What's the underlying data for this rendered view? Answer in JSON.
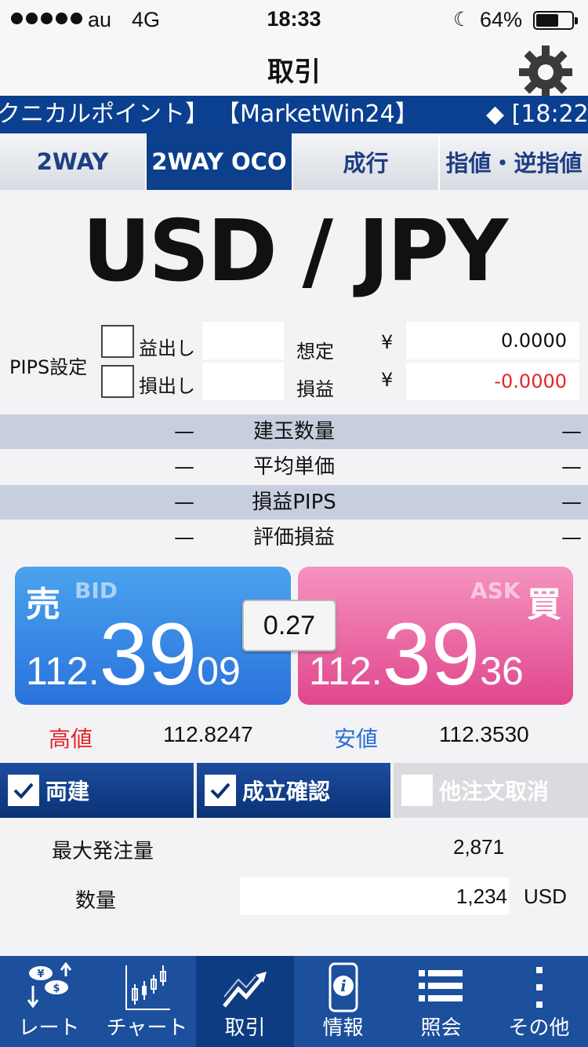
{
  "status_bar": {
    "carrier": "au",
    "network": "4G",
    "time": "18:33",
    "battery": "64%",
    "battery_level": 0.64
  },
  "header": {
    "title": "取引"
  },
  "ticker": {
    "part1": "クニカルポイント】",
    "part2": "【MarketWin24】",
    "part3": "◆ [18:22"
  },
  "order_tabs": [
    {
      "label": "2WAY"
    },
    {
      "label": "2WAY OCO"
    },
    {
      "label": "成行"
    },
    {
      "label": "指値・逆指値"
    }
  ],
  "pair": "USD / JPY",
  "pips": {
    "label": "PIPS設定",
    "take_profit_label": "益出し",
    "stop_loss_label": "損出し",
    "take_profit_value": "",
    "stop_loss_value": ""
  },
  "estimate": {
    "label_top": "想定",
    "label_bottom": "損益",
    "currency": "¥",
    "profit": "0.0000",
    "loss": "-0.0000"
  },
  "positions": [
    {
      "left": "—",
      "label": "建玉数量",
      "right": "—"
    },
    {
      "left": "—",
      "label": "平均単価",
      "right": "—"
    },
    {
      "left": "—",
      "label": "損益PIPS",
      "right": "—"
    },
    {
      "left": "—",
      "label": "評価損益",
      "right": "—"
    }
  ],
  "bid": {
    "kanji": "売",
    "label": "BID",
    "prefix": "112.",
    "main": "39",
    "suffix": "09"
  },
  "ask": {
    "kanji": "買",
    "label": "ASK",
    "prefix": "112.",
    "main": "39",
    "suffix": "36"
  },
  "spread": "0.27",
  "high": {
    "label": "高値",
    "value": "112.8247"
  },
  "low": {
    "label": "安値",
    "value": "112.3530"
  },
  "options": [
    {
      "label": "両建",
      "checked": true
    },
    {
      "label": "成立確認",
      "checked": true
    },
    {
      "label": "他注文取消",
      "checked": false
    }
  ],
  "max_order": {
    "label": "最大発注量",
    "value": "2,871"
  },
  "quantity": {
    "label": "数量",
    "value": "1,234",
    "unit": "USD"
  },
  "nav": [
    {
      "label": "レート",
      "icon": "rate-icon"
    },
    {
      "label": "チャート",
      "icon": "chart-icon"
    },
    {
      "label": "取引",
      "icon": "trade-icon"
    },
    {
      "label": "情報",
      "icon": "info-icon"
    },
    {
      "label": "照会",
      "icon": "list-icon"
    },
    {
      "label": "その他",
      "icon": "more-icon"
    }
  ],
  "colors": {
    "navy": "#0c3f8c",
    "bid": "#2a72dc",
    "ask": "#e0468d",
    "red": "#e2262c",
    "nav": "#1c4f9c"
  }
}
